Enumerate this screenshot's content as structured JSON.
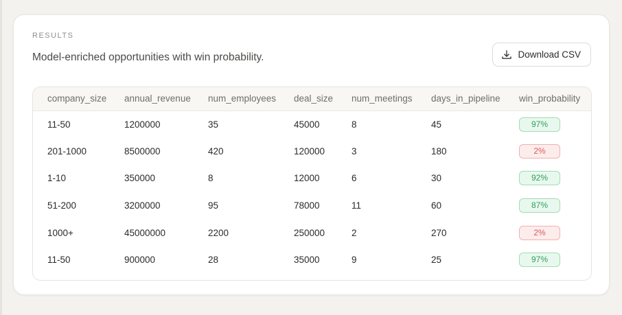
{
  "section": {
    "eyebrow": "RESULTS",
    "subtitle": "Model-enriched opportunities with win probability.",
    "download_label": "Download CSV"
  },
  "table": {
    "columns": [
      "company_size",
      "annual_revenue",
      "num_employees",
      "deal_size",
      "num_meetings",
      "days_in_pipeline",
      "win_probability"
    ],
    "rows": [
      {
        "company_size": "11-50",
        "annual_revenue": "1200000",
        "num_employees": "35",
        "deal_size": "45000",
        "num_meetings": "8",
        "days_in_pipeline": "45",
        "win_probability": "97%",
        "level": "high"
      },
      {
        "company_size": "201-1000",
        "annual_revenue": "8500000",
        "num_employees": "420",
        "deal_size": "120000",
        "num_meetings": "3",
        "days_in_pipeline": "180",
        "win_probability": "2%",
        "level": "low"
      },
      {
        "company_size": "1-10",
        "annual_revenue": "350000",
        "num_employees": "8",
        "deal_size": "12000",
        "num_meetings": "6",
        "days_in_pipeline": "30",
        "win_probability": "92%",
        "level": "high"
      },
      {
        "company_size": "51-200",
        "annual_revenue": "3200000",
        "num_employees": "95",
        "deal_size": "78000",
        "num_meetings": "11",
        "days_in_pipeline": "60",
        "win_probability": "87%",
        "level": "high"
      },
      {
        "company_size": "1000+",
        "annual_revenue": "45000000",
        "num_employees": "2200",
        "deal_size": "250000",
        "num_meetings": "2",
        "days_in_pipeline": "270",
        "win_probability": "2%",
        "level": "low"
      },
      {
        "company_size": "11-50",
        "annual_revenue": "900000",
        "num_employees": "28",
        "deal_size": "35000",
        "num_meetings": "9",
        "days_in_pipeline": "25",
        "win_probability": "97%",
        "level": "high"
      }
    ]
  },
  "colors": {
    "high_text": "#2e9f5c",
    "low_text": "#d85c5c"
  },
  "icons": {
    "download": "download-icon"
  }
}
